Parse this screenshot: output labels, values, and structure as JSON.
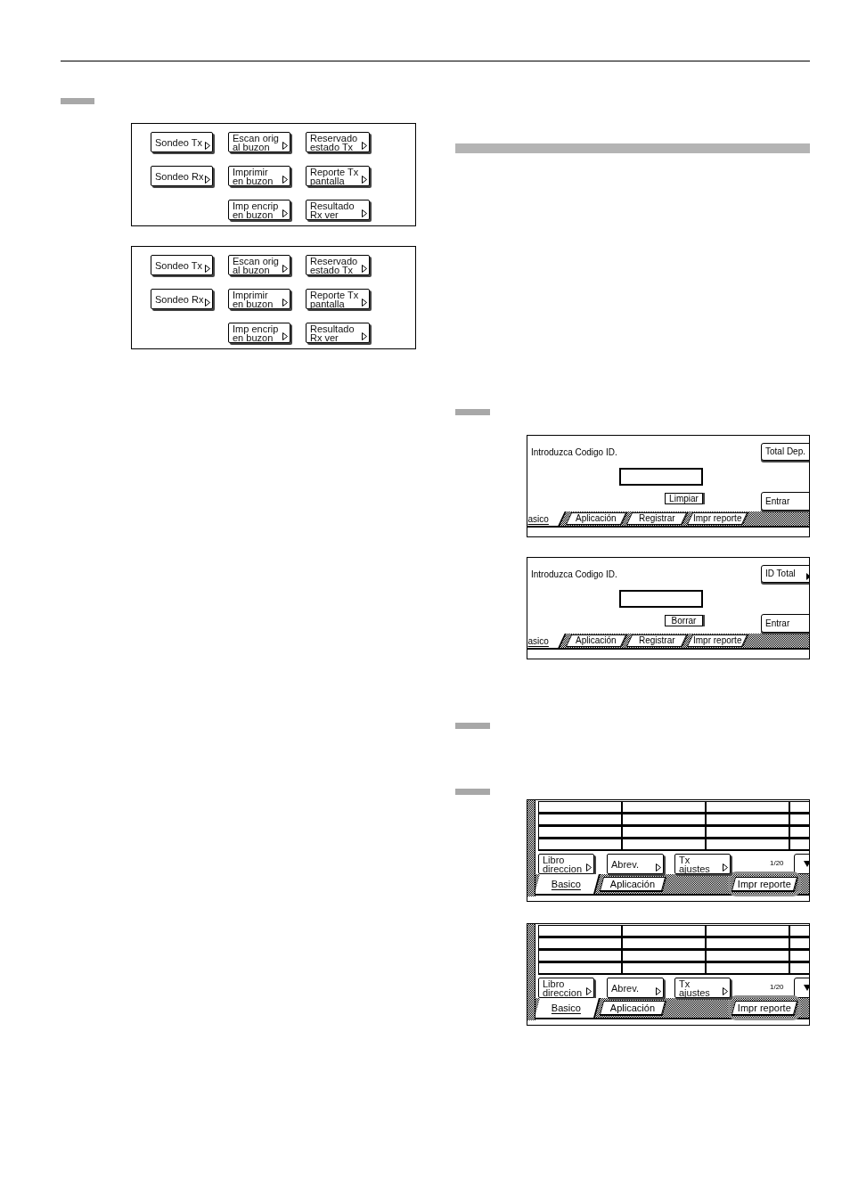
{
  "polling_panels": [
    {
      "columns": [
        [
          {
            "lines": [
              "Sondeo Tx"
            ]
          },
          {
            "lines": [
              "Sondeo Rx"
            ]
          }
        ],
        [
          {
            "lines": [
              "Escan orig",
              "al buzon"
            ]
          },
          {
            "lines": [
              "Imprimir",
              "en buzon"
            ]
          },
          {
            "lines": [
              "Imp encrip",
              "en buzon"
            ]
          }
        ],
        [
          {
            "lines": [
              "Reservado",
              "estado Tx"
            ]
          },
          {
            "lines": [
              "Reporte Tx",
              "pantalla"
            ]
          },
          {
            "lines": [
              "Resultado",
              "Rx ver"
            ]
          }
        ]
      ]
    },
    {
      "columns": [
        [
          {
            "lines": [
              "Sondeo Tx"
            ]
          },
          {
            "lines": [
              "Sondeo Rx"
            ]
          }
        ],
        [
          {
            "lines": [
              "Escan orig",
              "al buzon"
            ]
          },
          {
            "lines": [
              "Imprimir",
              "en buzon"
            ]
          },
          {
            "lines": [
              "Imp encrip",
              "en buzon"
            ]
          }
        ],
        [
          {
            "lines": [
              "Reservado",
              "estado Tx"
            ]
          },
          {
            "lines": [
              "Reporte Tx",
              "pantalla"
            ]
          },
          {
            "lines": [
              "Resultado",
              "Rx ver"
            ]
          }
        ]
      ]
    }
  ],
  "id_panels": [
    {
      "prompt": "Introduzca Codigo ID.",
      "clear_button": "Limpiar",
      "side_buttons": [
        {
          "label": "Total Dep.",
          "arrow": false
        },
        {
          "label": "Entrar",
          "arrow": false
        }
      ],
      "tabs": [
        {
          "label": "asico",
          "selected": true
        },
        {
          "label": "Aplicación",
          "selected": false
        },
        {
          "label": "Registrar",
          "selected": false
        },
        {
          "label": "Impr reporte",
          "selected": false
        }
      ]
    },
    {
      "prompt": "Introduzca Codigo ID.",
      "clear_button": "Borrar",
      "side_buttons": [
        {
          "label": "ID Total",
          "arrow": true
        },
        {
          "label": "Entrar",
          "arrow": false
        }
      ],
      "tabs": [
        {
          "label": "asico",
          "selected": true
        },
        {
          "label": "Aplicación",
          "selected": false
        },
        {
          "label": "Registrar",
          "selected": false
        },
        {
          "label": "Impr reporte",
          "selected": false
        }
      ]
    }
  ],
  "address_panels": [
    {
      "buttons": [
        {
          "lines": [
            "Libro",
            "direccion"
          ]
        },
        {
          "lines": [
            "Abrev."
          ]
        },
        {
          "lines": [
            "Tx",
            "ajustes"
          ]
        }
      ],
      "page_indicator": "1/20",
      "tabs": [
        {
          "label": "Basico",
          "selected": true,
          "highlighted": false
        },
        {
          "label": "Aplicación",
          "selected": false,
          "highlighted": false
        },
        {
          "label": "Impr reporte",
          "selected": false,
          "highlighted": true
        }
      ]
    },
    {
      "buttons": [
        {
          "lines": [
            "Libro",
            "direccion"
          ]
        },
        {
          "lines": [
            "Abrev."
          ]
        },
        {
          "lines": [
            "Tx",
            "ajustes"
          ]
        }
      ],
      "page_indicator": "1/20",
      "tabs": [
        {
          "label": "Basico",
          "selected": true,
          "highlighted": false
        },
        {
          "label": "Aplicación",
          "selected": false,
          "highlighted": false
        },
        {
          "label": "Impr reporte",
          "selected": false,
          "highlighted": true
        }
      ]
    }
  ]
}
